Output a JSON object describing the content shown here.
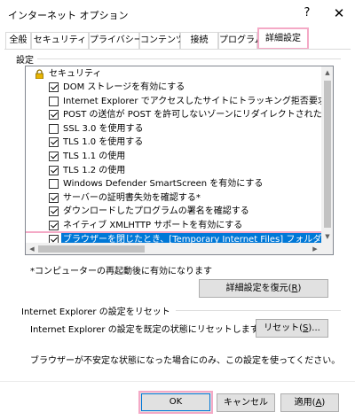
{
  "window": {
    "title": "インターネット オプション",
    "help_label": "?",
    "close_label": "✕"
  },
  "tabs": [
    {
      "label": "全般",
      "active": false
    },
    {
      "label": "セキュリティ",
      "active": false
    },
    {
      "label": "プライバシー",
      "active": false
    },
    {
      "label": "コンテンツ",
      "active": false
    },
    {
      "label": "接続",
      "active": false
    },
    {
      "label": "プログラム",
      "active": false
    },
    {
      "label": "詳細設定",
      "active": true
    }
  ],
  "settings": {
    "group_label": "設定",
    "category": "セキュリティ",
    "items": [
      {
        "label": "DOM ストレージを有効にする",
        "checked": true,
        "selected": false
      },
      {
        "label": "Internet Explorer でアクセスしたサイトにトラッキング拒否要求を送信す",
        "checked": false,
        "selected": false
      },
      {
        "label": "POST の送信が POST を許可しないゾーンにリダイレクトされた場合に警",
        "checked": true,
        "selected": false
      },
      {
        "label": "SSL 3.0 を使用する",
        "checked": false,
        "selected": false
      },
      {
        "label": "TLS 1.0 を使用する",
        "checked": true,
        "selected": false
      },
      {
        "label": "TLS 1.1 の使用",
        "checked": true,
        "selected": false
      },
      {
        "label": "TLS 1.2 の使用",
        "checked": true,
        "selected": false
      },
      {
        "label": "Windows Defender SmartScreen を有効にする",
        "checked": false,
        "selected": false
      },
      {
        "label": "サーバーの証明書失効を確認する*",
        "checked": true,
        "selected": false
      },
      {
        "label": "ダウンロードしたプログラムの署名を確認する",
        "checked": true,
        "selected": false
      },
      {
        "label": "ネイティブ XMLHTTP サポートを有効にする",
        "checked": true,
        "selected": false
      },
      {
        "label": "ブラウザーを閉じたとき、[Temporary Internet Files] フォルダーを空にする",
        "checked": true,
        "selected": true
      }
    ],
    "restart_note": "*コンピューターの再起動後に有効になります",
    "restore_button": {
      "label": "詳細設定を復元(",
      "key": "R",
      "suffix": ")"
    }
  },
  "reset": {
    "group_label": "Internet Explorer の設定をリセット",
    "description": "Internet Explorer の設定を既定の状態にリセットします。",
    "button": {
      "label": "リセット(",
      "key": "S",
      "suffix": ")..."
    },
    "warning": "ブラウザーが不安定な状態になった場合にのみ、この設定を使ってください。"
  },
  "footer": {
    "ok_label": "OK",
    "cancel_label": "キャンセル",
    "apply": {
      "label": "適用(",
      "key": "A",
      "suffix": ")"
    }
  },
  "colors": {
    "highlight": "#f4a9c6",
    "selection": "#0078d7"
  }
}
